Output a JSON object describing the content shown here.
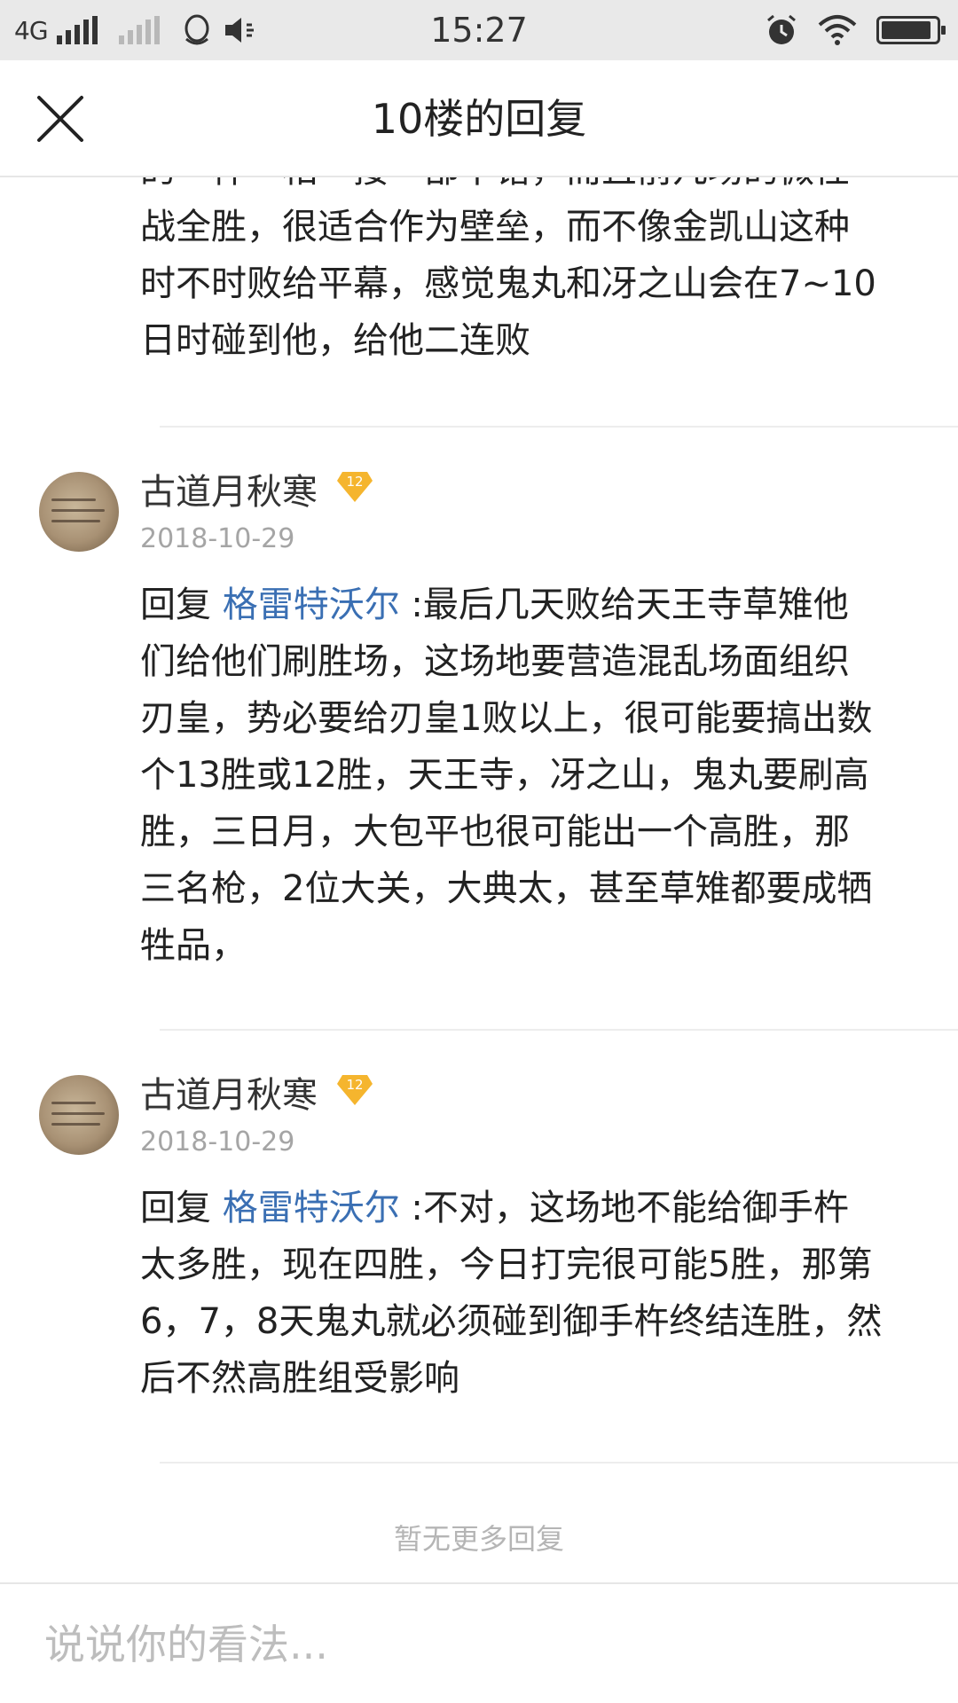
{
  "status_bar": {
    "network": "4G",
    "time": "15:27"
  },
  "header": {
    "title": "10楼的回复",
    "close_icon": "close-icon"
  },
  "partial_reply": {
    "lines": [
      "的一样一相一接一部不错，而且前几场的微性",
      "战全胜，很适合作为壁垒，而不像金凯山这种",
      "时不时败给平幕，感觉鬼丸和冴之山会在7~10",
      "日时碰到他，给他二连败"
    ]
  },
  "replies": [
    {
      "username": "古道月秋寒",
      "level": "12",
      "date": "2018-10-29",
      "reply_prefix": "回复 ",
      "mention": "格雷特沃尔",
      "text_first": " :最后几天败给天王寺草雉他",
      "lines": [
        "们给他们刷胜场，这场地要营造混乱场面组织",
        "刃皇，势必要给刃皇1败以上，很可能要搞出数",
        "个13胜或12胜，天王寺，冴之山，鬼丸要刷高",
        "胜，三日月，大包平也很可能出一个高胜，那",
        "三名枪，2位大关，大典太，甚至草雉都要成牺",
        "牲品，"
      ]
    },
    {
      "username": "古道月秋寒",
      "level": "12",
      "date": "2018-10-29",
      "reply_prefix": "回复 ",
      "mention": "格雷特沃尔",
      "text_first": " :不对，这场地不能给御手杵",
      "lines": [
        "太多胜，现在四胜，今日打完很可能5胜，那第",
        "6，7，8天鬼丸就必须碰到御手杵终结连胜，然",
        "后不然高胜组受影响"
      ]
    }
  ],
  "footer_note": "暂无更多回复",
  "comment_input": {
    "placeholder": "说说你的看法..."
  },
  "colors": {
    "mention": "#3a6fb3",
    "badge": "#f5b52e",
    "status_bar_bg": "#e9e9e9"
  }
}
